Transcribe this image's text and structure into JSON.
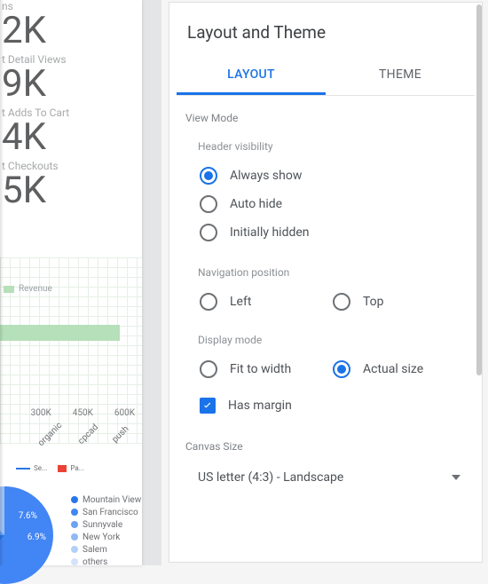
{
  "canvas": {
    "metrics": [
      {
        "label_suffix": "ns",
        "value": "2K"
      },
      {
        "label": "t Detail Views",
        "value": "9K"
      },
      {
        "label": "t Adds To Cart",
        "value": "4K"
      },
      {
        "label": "t Checkouts",
        "value": "5K"
      }
    ],
    "revenue_legend": "Revenue",
    "revenue_swatch": "#b5e0b9",
    "axis_ticks": [
      "300K",
      "450K",
      "600K"
    ],
    "diag_labels": [
      "organic",
      "cpcad",
      "push"
    ],
    "mini_legend": [
      {
        "color": "#2a76e8",
        "label": "Se..."
      },
      {
        "color": "#ea4335",
        "label": "Pa..."
      }
    ],
    "pie_pct": [
      "7.6%",
      "6.9%"
    ],
    "cities": [
      {
        "color": "#2a76e8",
        "label": "Mountain View"
      },
      {
        "color": "#4285f4",
        "label": "San Francisco"
      },
      {
        "color": "#6ba3f1",
        "label": "Sunnyvale"
      },
      {
        "color": "#8fbaf5",
        "label": "New York"
      },
      {
        "color": "#b3d0f8",
        "label": "Salem"
      },
      {
        "color": "#d3e3fb",
        "label": "others"
      }
    ]
  },
  "panel": {
    "title": "Layout and Theme",
    "tabs": {
      "layout": "LAYOUT",
      "theme": "THEME"
    },
    "view_mode": "View Mode",
    "header_visibility": {
      "label": "Header visibility",
      "options": {
        "always": "Always show",
        "auto": "Auto hide",
        "initial": "Initially hidden"
      },
      "selected": "always"
    },
    "nav_position": {
      "label": "Navigation position",
      "options": {
        "left": "Left",
        "top": "Top"
      }
    },
    "display_mode": {
      "label": "Display mode",
      "options": {
        "fit": "Fit to width",
        "actual": "Actual size"
      },
      "selected": "actual"
    },
    "has_margin": "Has margin",
    "canvas_size": {
      "label": "Canvas Size",
      "value": "US letter (4:3) - Landscape"
    }
  }
}
